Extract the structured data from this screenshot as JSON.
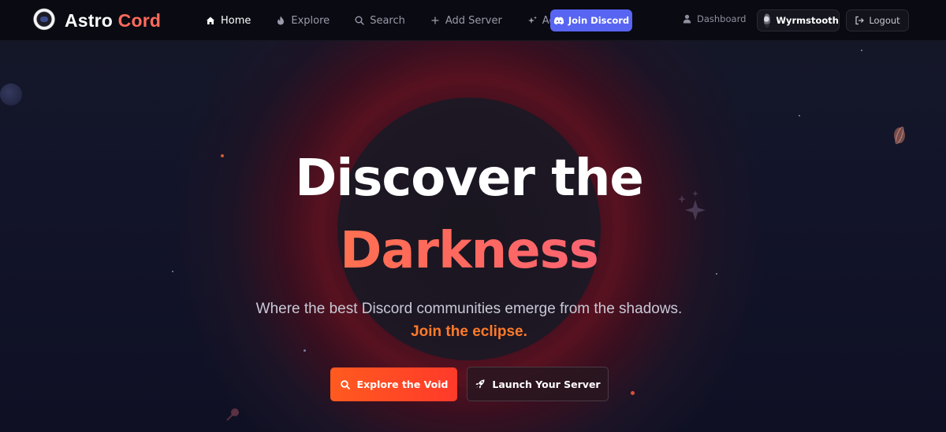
{
  "brand": {
    "name_part1": "Astro",
    "name_part2": "Cord"
  },
  "nav": {
    "links": [
      {
        "label": "Home",
        "icon": "home-icon",
        "active": true
      },
      {
        "label": "Explore",
        "icon": "flame-icon",
        "active": false
      },
      {
        "label": "Search",
        "icon": "search-icon",
        "active": false
      },
      {
        "label": "Add Server",
        "icon": "plus-icon",
        "active": false
      },
      {
        "label": "Admin",
        "icon": "sparkle-icon",
        "active": false
      }
    ],
    "join_discord": "Join Discord",
    "dashboard": "Dashboard",
    "username": "Wyrmstooth",
    "logout": "Logout"
  },
  "hero": {
    "title_line1": "Discover the",
    "title_line2": "Darkness",
    "subtitle": "Where the best Discord communities emerge from the shadows.",
    "tagline": "Join the eclipse.",
    "cta_primary": "Explore the Void",
    "cta_secondary": "Launch Your Server"
  },
  "colors": {
    "accent_orange": "#ff5a1f",
    "accent_pink": "#f35aa0",
    "discord_blurple": "#5865f2",
    "background": "#0c0d1a"
  }
}
